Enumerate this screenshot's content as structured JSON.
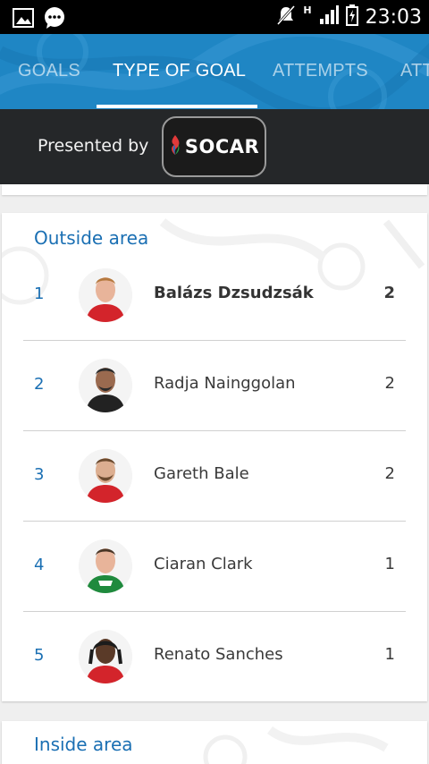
{
  "status_bar": {
    "time": "23:03",
    "network": "H",
    "icons": [
      "image-icon",
      "chat-icon",
      "mute-icon",
      "signal-icon",
      "battery-charging-icon"
    ]
  },
  "tabs": [
    {
      "label": "GOALS",
      "active": false
    },
    {
      "label": "TYPE OF GOAL",
      "active": true
    },
    {
      "label": "ATTEMPTS",
      "active": false
    },
    {
      "label": "ATT",
      "active": false
    }
  ],
  "sponsor": {
    "presented_by": "Presented by",
    "brand": "SOCAR"
  },
  "sections": [
    {
      "title": "Outside area",
      "players": [
        {
          "rank": "1",
          "name": "Balázs Dzsudzsák",
          "goals": "2",
          "highlight": true
        },
        {
          "rank": "2",
          "name": "Radja Nainggolan",
          "goals": "2",
          "highlight": false
        },
        {
          "rank": "3",
          "name": "Gareth Bale",
          "goals": "2",
          "highlight": false
        },
        {
          "rank": "4",
          "name": "Ciaran Clark",
          "goals": "1",
          "highlight": false
        },
        {
          "rank": "5",
          "name": "Renato Sanches",
          "goals": "1",
          "highlight": false
        }
      ]
    },
    {
      "title": "Inside area"
    }
  ],
  "colors": {
    "tab_bar": "#1f86c4",
    "accent_blue": "#1a6fb3",
    "sponsor_bar": "#252729"
  }
}
